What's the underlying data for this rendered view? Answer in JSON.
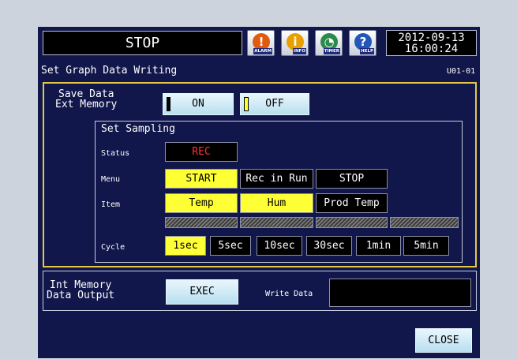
{
  "header": {
    "status": "STOP",
    "date": "2012-09-13",
    "time": "16:00:24",
    "buttons": [
      {
        "caption": "ALARM",
        "icon": "alarm-icon",
        "glyph": "!",
        "color": "#e05a10"
      },
      {
        "caption": "INFO",
        "icon": "info-icon",
        "glyph": "i",
        "color": "#e8a000"
      },
      {
        "caption": "TIMER",
        "icon": "timer-icon",
        "glyph": "◔",
        "color": "#2b8a4a"
      },
      {
        "caption": "HELP",
        "icon": "help-icon",
        "glyph": "?",
        "color": "#2456b8"
      }
    ]
  },
  "page": {
    "title": "Set Graph Data Writing",
    "code": "U01-01"
  },
  "ext_memory": {
    "label_line1": "Save Data",
    "label_line2": "Ext Memory",
    "on_label": "ON",
    "off_label": "OFF"
  },
  "sampling": {
    "title": "Set Sampling",
    "status_label": "Status",
    "status_value": "REC",
    "menu_label": "Menu",
    "menu_items": [
      "START",
      "Rec in Run",
      "STOP"
    ],
    "menu_selected": 0,
    "item_label": "Item",
    "items": [
      "Temp",
      "Hum",
      "Prod Temp"
    ],
    "items_selected": [
      0,
      1
    ],
    "cycle_label": "Cycle",
    "cycles": [
      "1sec",
      "5sec",
      "10sec",
      "30sec",
      "1min",
      "5min"
    ],
    "cycle_selected": 0
  },
  "int_memory": {
    "label_line1": "Int Memory",
    "label_line2": "Data Output",
    "exec_label": "EXEC",
    "write_label": "Write Data"
  },
  "close_label": "CLOSE",
  "colors": {
    "screen": "#11174a",
    "frame": "#e3c84a",
    "selected": "#ffff35",
    "rec": "#ff3030"
  }
}
